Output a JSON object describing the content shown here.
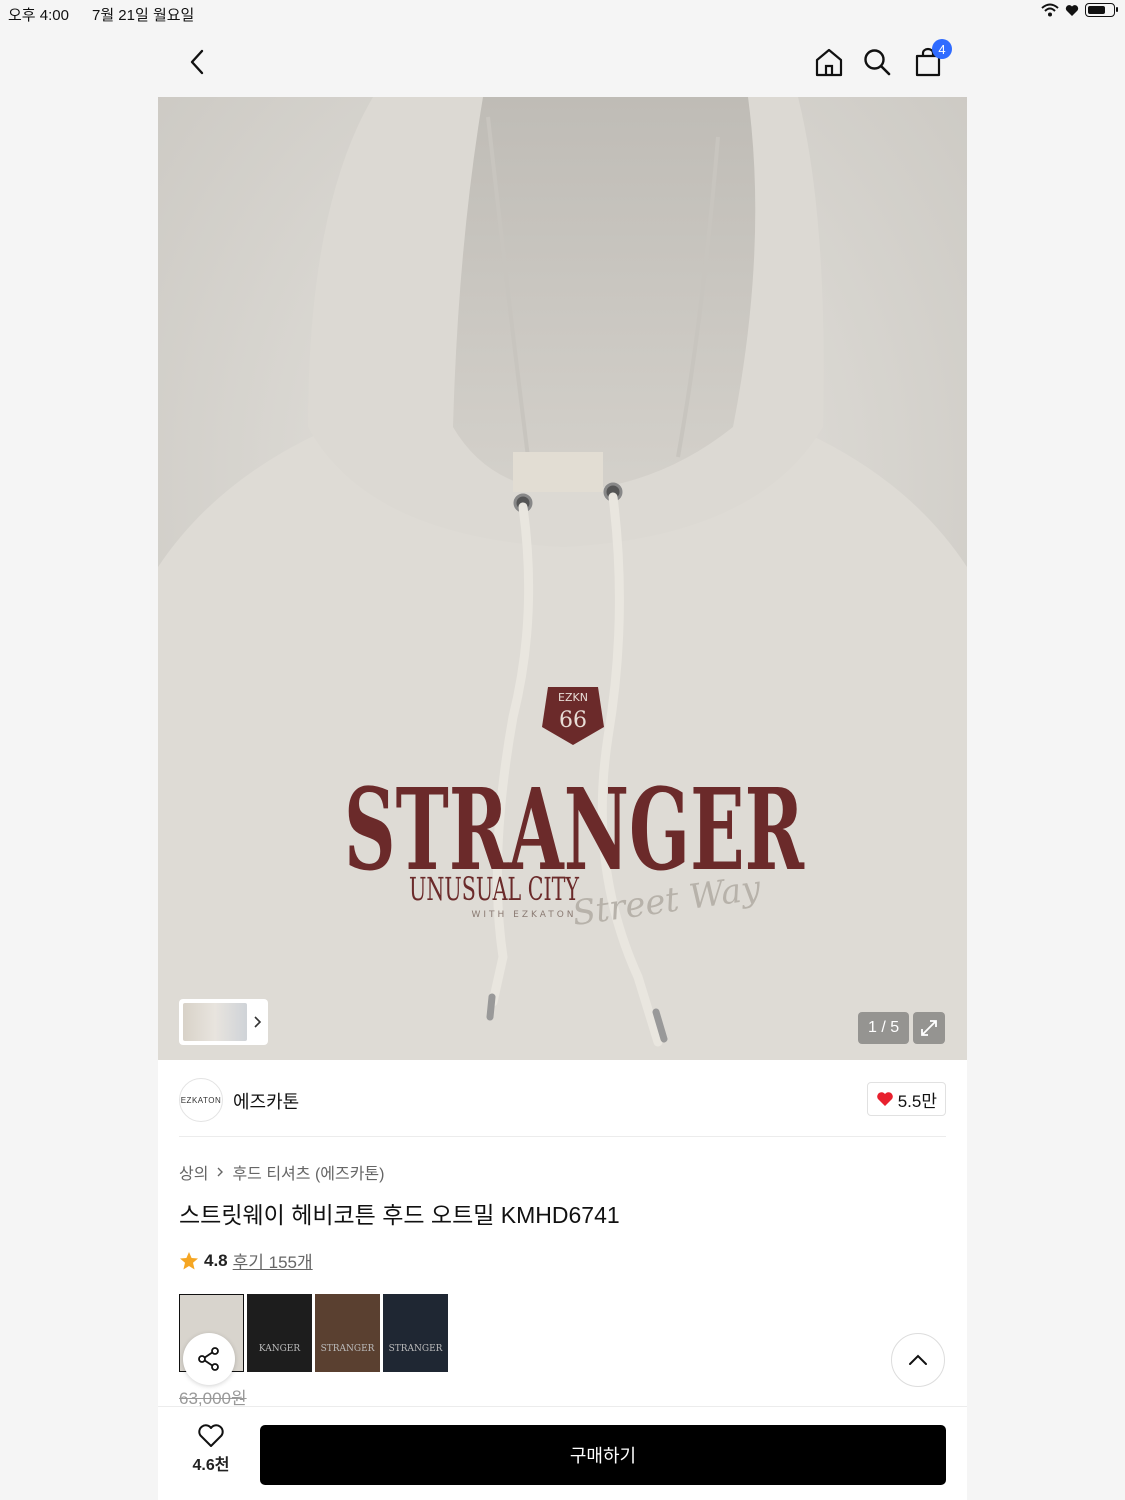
{
  "status_bar": {
    "time": "오후 4:00",
    "date": "7월 21일 월요일",
    "battery_level": 0.75
  },
  "nav": {
    "icons": [
      "back-icon",
      "home-icon",
      "search-icon",
      "cart-icon"
    ],
    "cart_count": "4",
    "badge_color": "#2f6bff"
  },
  "hero": {
    "counter": "1 / 5",
    "graphic_text": {
      "shield_top": "EZKN",
      "shield_num": "66",
      "main": "STRANGER",
      "sub": "UNUSUAL CITY",
      "script": "Street Way",
      "small": "WITH EZKATON"
    }
  },
  "brand": {
    "logo_text": "EZKATON",
    "name": "에즈카톤",
    "likes": "5.5만"
  },
  "product": {
    "breadcrumb": [
      "상의",
      "후드 티셔츠 (에즈카톤)"
    ],
    "title": "스트릿웨이 헤비코튼 후드 오트밀 KMHD6741",
    "rating": "4.8",
    "reviews": "후기 155개",
    "original_price": "63,000원",
    "swatches": [
      {
        "color": "#d8d4cd",
        "text": ""
      },
      {
        "color": "#1d1d1d",
        "text": "KANGER"
      },
      {
        "color": "#5a4030",
        "text": "STRANGER"
      },
      {
        "color": "#1f2733",
        "text": "STRANGER"
      }
    ]
  },
  "footer": {
    "wish_count": "4.6천",
    "buy_label": "구매하기"
  },
  "colors": {
    "accent": "#2f6bff",
    "heart": "#e8202e",
    "star": "#f5a623",
    "embroidery": "#6b2a2a"
  }
}
